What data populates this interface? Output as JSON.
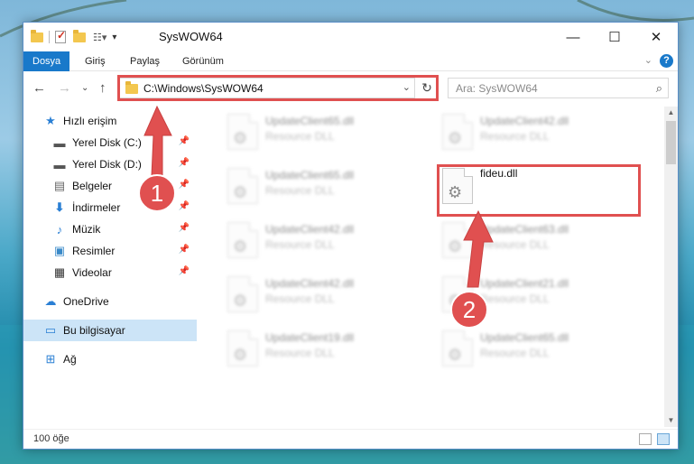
{
  "window": {
    "title": "SysWOW64"
  },
  "controls": {
    "minimize": "—",
    "maximize": "☐",
    "close": "✕"
  },
  "ribbon": {
    "tabs": [
      {
        "label": "Dosya",
        "active": true
      },
      {
        "label": "Giriş"
      },
      {
        "label": "Paylaş"
      },
      {
        "label": "Görünüm"
      }
    ],
    "help": "?"
  },
  "nav": {
    "address": "C:\\Windows\\SysWOW64",
    "search_placeholder": "Ara: SysWOW64"
  },
  "sidebar": {
    "items": [
      {
        "label": "Hızlı erişim",
        "icon": "star-icon"
      },
      {
        "label": "Yerel Disk (C:)",
        "icon": "drive-icon",
        "pinned": true
      },
      {
        "label": "Yerel Disk (D:)",
        "icon": "drive-icon",
        "pinned": true
      },
      {
        "label": "Belgeler",
        "icon": "document-icon",
        "pinned": true
      },
      {
        "label": "İndirmeler",
        "icon": "download-icon",
        "pinned": true
      },
      {
        "label": "Müzik",
        "icon": "music-icon",
        "pinned": true
      },
      {
        "label": "Resimler",
        "icon": "picture-icon",
        "pinned": true
      },
      {
        "label": "Videolar",
        "icon": "video-icon",
        "pinned": true
      },
      {
        "label": "OneDrive",
        "icon": "cloud-icon"
      },
      {
        "label": "Bu bilgisayar",
        "icon": "computer-icon",
        "selected": true
      },
      {
        "label": "Ağ",
        "icon": "network-icon"
      }
    ]
  },
  "files": [
    {
      "name": "UpdateClient65.dll",
      "type": "Resource DLL"
    },
    {
      "name": "UpdateClient42.dll",
      "type": "Resource DLL"
    },
    {
      "name": "UpdateClient65.dll",
      "type": "Resource DLL"
    },
    {
      "name": "fideu.dll",
      "type": "",
      "highlighted": true
    },
    {
      "name": "UpdateClient42.dll",
      "type": "Resource DLL"
    },
    {
      "name": "UpdateClient63.dll",
      "type": "Resource DLL"
    },
    {
      "name": "UpdateClient42.dll",
      "type": "Resource DLL"
    },
    {
      "name": "UpdateClient21.dll",
      "type": "Resource DLL"
    },
    {
      "name": "UpdateClient19.dll",
      "type": "Resource DLL"
    },
    {
      "name": "UpdateClient65.dll",
      "type": "Resource DLL"
    }
  ],
  "status": {
    "count": "100 öğe"
  },
  "annotations": {
    "step1": "1",
    "step2": "2",
    "color": "#e05050"
  }
}
